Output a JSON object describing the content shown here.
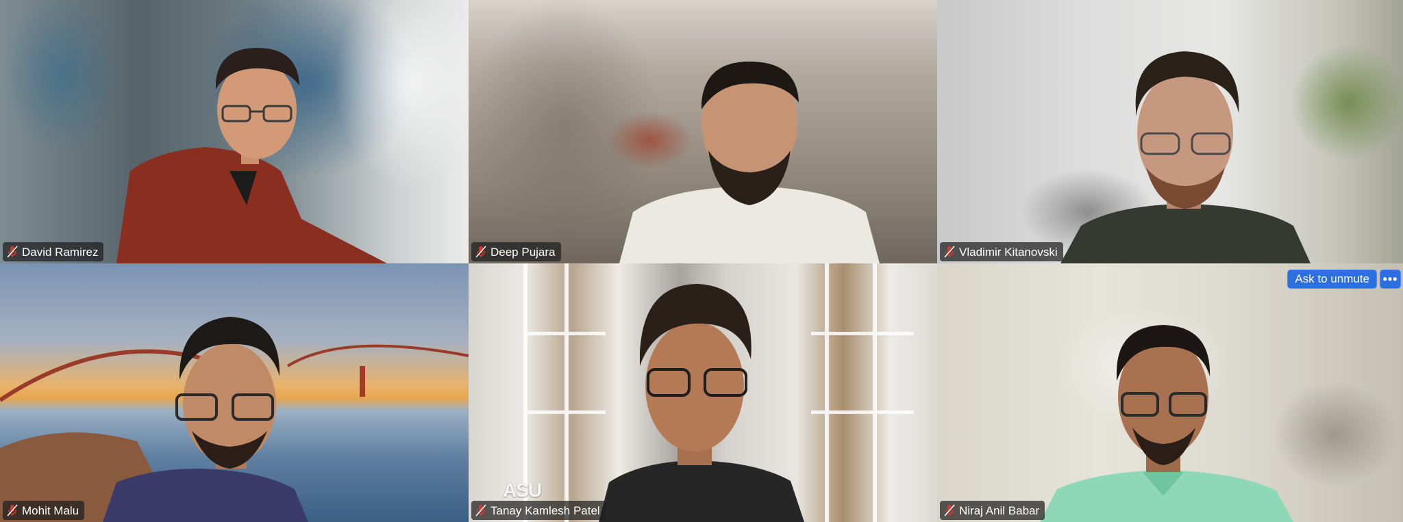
{
  "participants": [
    {
      "name": "David Ramirez",
      "muted": true
    },
    {
      "name": "Deep Pujara",
      "muted": true
    },
    {
      "name": "Vladimir Kitanovski",
      "muted": true
    },
    {
      "name": "Mohit Malu",
      "muted": true
    },
    {
      "name": "Tanay Kamlesh Patel",
      "muted": true
    },
    {
      "name": "Niraj Anil Babar",
      "muted": true
    }
  ],
  "controls": {
    "ask_to_unmute_label": "Ask to unmute",
    "more_label": "•••"
  },
  "background_text": {
    "asu_logo": "ASU"
  },
  "colors": {
    "button_blue": "#2d6fe0",
    "muted_mic_red": "#e0352b",
    "name_tag_bg": "rgba(30,30,30,0.72)"
  },
  "icons": {
    "muted_mic": "mic-muted-icon"
  }
}
